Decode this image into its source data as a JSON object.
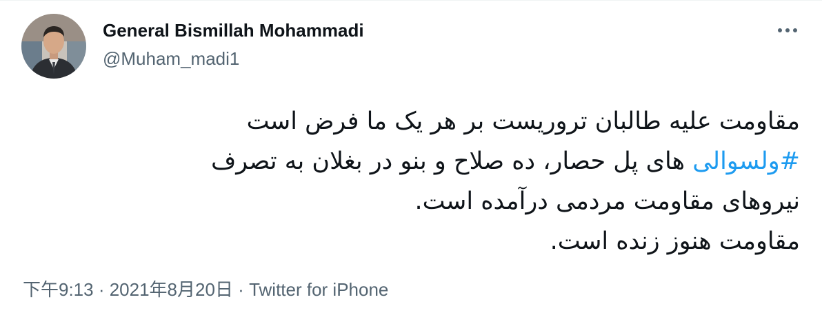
{
  "author": {
    "display_name": "General Bismillah Mohammadi",
    "handle": "@Muham_madi1",
    "avatar_icon": "user-avatar"
  },
  "more_icon": "more-horizontal-icon",
  "tweet": {
    "line1": "مقاومت علیه طالبان تروریست بر هر یک ما فرض است",
    "line2_hashtag": "#ولسوالی",
    "line2_rest": " های پل حصار، ده صلاح و بنو در بغلان به تصرف",
    "line3": "نیروهای مقاومت مردمی درآمده است.",
    "line4": "مقاومت هنوز زنده است."
  },
  "meta": {
    "time": "下午9:13",
    "separator": " · ",
    "date": "2021年8月20日",
    "source": "Twitter for iPhone"
  },
  "colors": {
    "text": "#0f1419",
    "secondary": "#536471",
    "link": "#1d9bf0"
  }
}
